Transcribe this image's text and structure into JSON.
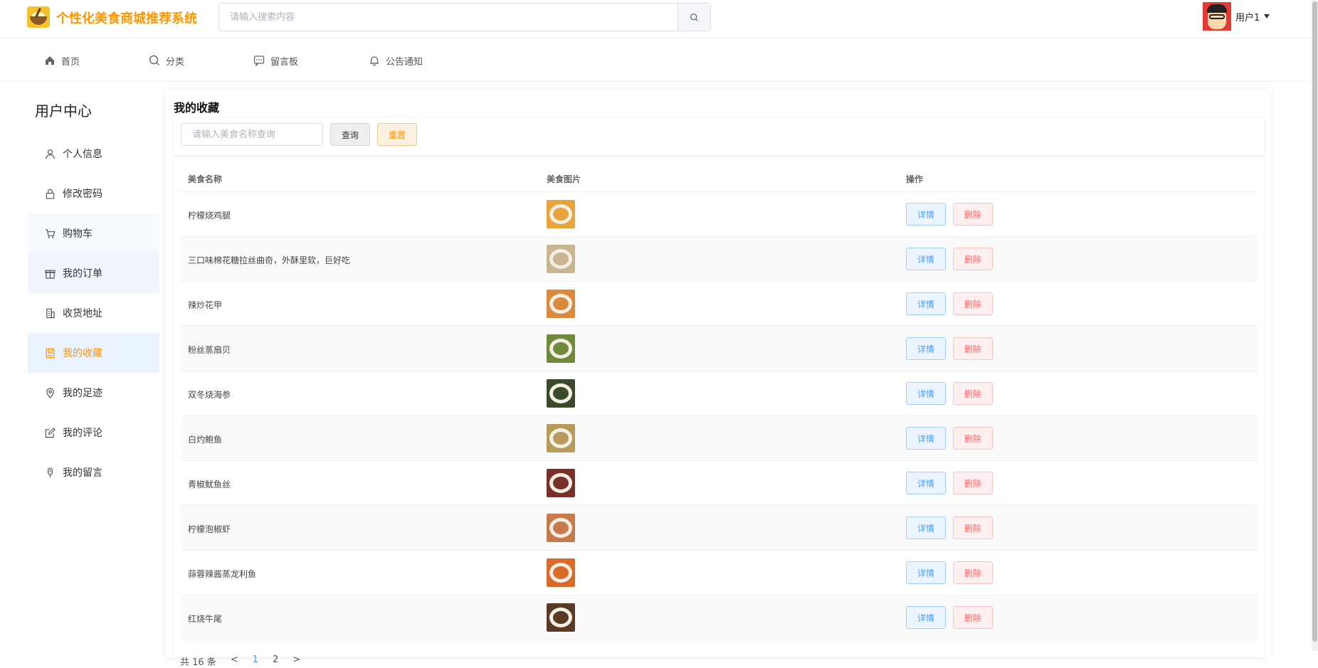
{
  "header": {
    "site_title": "个性化美食商城推荐系统",
    "search_placeholder": "请输入搜索内容",
    "user_name": "用户1"
  },
  "nav": {
    "items": [
      {
        "label": "首页",
        "icon": "home-icon"
      },
      {
        "label": "分类",
        "icon": "search-icon"
      },
      {
        "label": "留言板",
        "icon": "chat-icon"
      },
      {
        "label": "公告通知",
        "icon": "bell-icon"
      }
    ]
  },
  "sidebar": {
    "title": "用户中心",
    "items": [
      {
        "label": "个人信息",
        "icon": "user-icon"
      },
      {
        "label": "修改密码",
        "icon": "lock-icon"
      },
      {
        "label": "购物车",
        "icon": "cart-icon"
      },
      {
        "label": "我的订单",
        "icon": "gift-icon"
      },
      {
        "label": "收货地址",
        "icon": "building-icon"
      },
      {
        "label": "我的收藏",
        "icon": "bookmark-icon",
        "active": true
      },
      {
        "label": "我的足迹",
        "icon": "location-icon"
      },
      {
        "label": "我的评论",
        "icon": "edit-icon"
      },
      {
        "label": "我的留言",
        "icon": "mic-icon"
      }
    ]
  },
  "main": {
    "title": "我的收藏",
    "query": {
      "placeholder": "请输入美食名称查询",
      "query_label": "查询",
      "reset_label": "重置"
    },
    "table": {
      "headers": [
        "美食名称",
        "美食图片",
        "操作"
      ],
      "detail_label": "详情",
      "delete_label": "删除",
      "rows": [
        {
          "name": "柠檬烧鸡腿",
          "color": "#e8a33a"
        },
        {
          "name": "三口味棉花糖拉丝曲奇，外酥里软，巨好吃",
          "color": "#c9b58f"
        },
        {
          "name": "辣炒花甲",
          "color": "#d98a3c"
        },
        {
          "name": "粉丝蒸扇贝",
          "color": "#6f8a3a"
        },
        {
          "name": "双冬烧海参",
          "color": "#3b4a2a"
        },
        {
          "name": "白灼鲍鱼",
          "color": "#b89a5a"
        },
        {
          "name": "青椒鱿鱼丝",
          "color": "#7a2f2a"
        },
        {
          "name": "柠檬泡椒虾",
          "color": "#c87a4a"
        },
        {
          "name": "蒜蓉辣酱蒸龙利鱼",
          "color": "#d96a2a"
        },
        {
          "name": "红烧牛尾",
          "color": "#5a3a22"
        }
      ]
    },
    "pager": {
      "total": "共 16 条",
      "prev": "<",
      "page1": "1",
      "page2": "2",
      "next": ">"
    }
  }
}
